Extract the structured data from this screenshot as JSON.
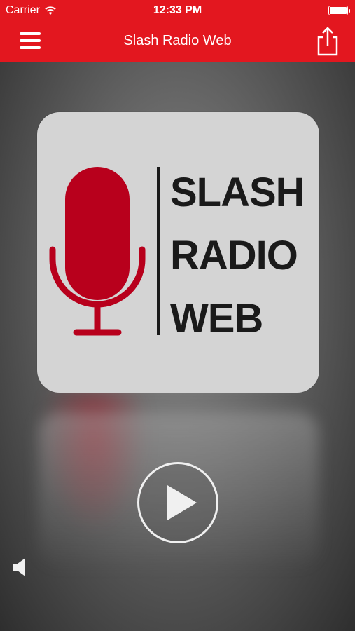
{
  "status_bar": {
    "carrier": "Carrier",
    "time": "12:33 PM",
    "wifi_icon": "wifi-icon",
    "battery_icon": "battery-icon"
  },
  "nav": {
    "title": "Slash Radio Web",
    "menu_icon": "hamburger-menu-icon",
    "share_icon": "share-icon"
  },
  "artwork": {
    "logo_lines": [
      "SLASH",
      "RADIO",
      "WEB"
    ],
    "mic_color": "#b8001c",
    "background_color": "#d4d4d4"
  },
  "player": {
    "play_icon": "play-icon",
    "volume_icon": "speaker-icon"
  },
  "colors": {
    "accent": "#e3171f",
    "text_on_accent": "#ffffff"
  }
}
